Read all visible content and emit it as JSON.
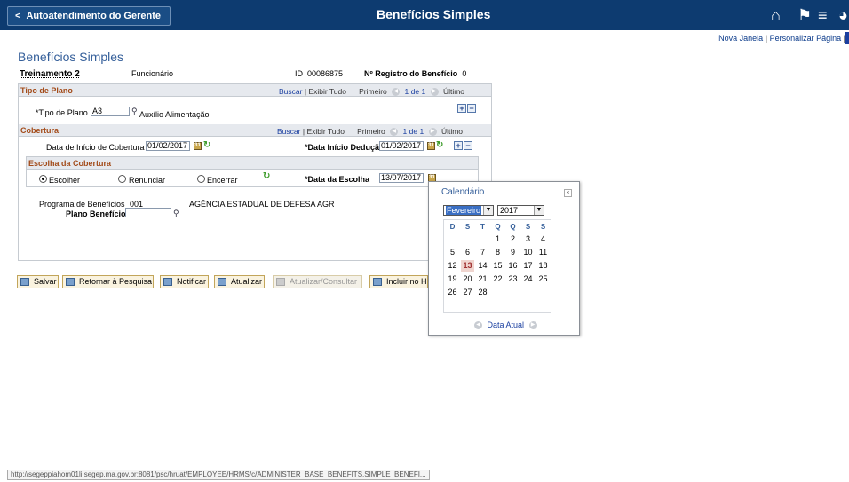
{
  "topbar": {
    "back_label": "Autoatendimento do Gerente",
    "title": "Benefícios Simples"
  },
  "toplinks": {
    "new_window": "Nova Janela",
    "separator": "|",
    "personalize": "Personalizar Página"
  },
  "page_title": "Benefícios Simples",
  "employee": {
    "name": "Treinamento 2",
    "role": "Funcionário",
    "id_label": "ID",
    "id_value": "00086875",
    "reg_label": "Nº Registro do Benefício",
    "reg_value": "0"
  },
  "tipo_plano": {
    "header": "Tipo de Plano",
    "search": "Buscar",
    "sep": "|",
    "show_all": "Exibir Tudo",
    "first": "Primeiro",
    "range": "1 de 1",
    "last": "Último",
    "field_label": "*Tipo de Plano",
    "field_value": "A3",
    "field_desc": "Auxílio Alimentação"
  },
  "cobertura": {
    "header": "Cobertura",
    "search": "Buscar",
    "sep": "|",
    "show_all": "Exibir Tudo",
    "first": "Primeiro",
    "range": "1 de 1",
    "last": "Último",
    "start_label": "Data de Início de Cobertura",
    "start_value": "01/02/2017",
    "deduct_label": "*Data Início Dedução",
    "deduct_value": "01/02/2017"
  },
  "escolha": {
    "header": "Escolha da Cobertura",
    "opt_choose": "Escolher",
    "opt_waive": "Renunciar",
    "opt_end": "Encerrar",
    "date_label": "*Data da Escolha",
    "date_value": "13/07/2017"
  },
  "programa": {
    "label": "Programa de Benefícios",
    "code": "001",
    "desc": "AGÊNCIA ESTADUAL DE DEFESA AGR",
    "plan_label": "Plano Benefícios",
    "plan_value": ""
  },
  "toolbar": {
    "save": "Salvar",
    "return": "Retornar à Pesquisa",
    "notify": "Notificar",
    "refresh": "Atualizar",
    "update_view": "Atualizar/Consultar",
    "include": "Incluir no H"
  },
  "calendar": {
    "title": "Calendário",
    "close": "×",
    "month": "Fevereiro",
    "year": "2017",
    "weekdays": [
      "D",
      "S",
      "T",
      "Q",
      "Q",
      "S",
      "S"
    ],
    "weeks": [
      [
        "",
        "",
        "",
        "1",
        "2",
        "3",
        "4"
      ],
      [
        "5",
        "6",
        "7",
        "8",
        "9",
        "10",
        "11"
      ],
      [
        "12",
        "13",
        "14",
        "15",
        "16",
        "17",
        "18"
      ],
      [
        "19",
        "20",
        "21",
        "22",
        "23",
        "24",
        "25"
      ],
      [
        "26",
        "27",
        "28",
        "",
        "",
        "",
        ""
      ]
    ],
    "selected": "13",
    "today_label": "Data Atual"
  },
  "status_url": "http://segeppiahom01li.segep.ma.gov.br:8081/psc/hruat/EMPLOYEE/HRMS/c/ADMINISTER_BASE_BENEFITS.SIMPLE_BENEFI..."
}
